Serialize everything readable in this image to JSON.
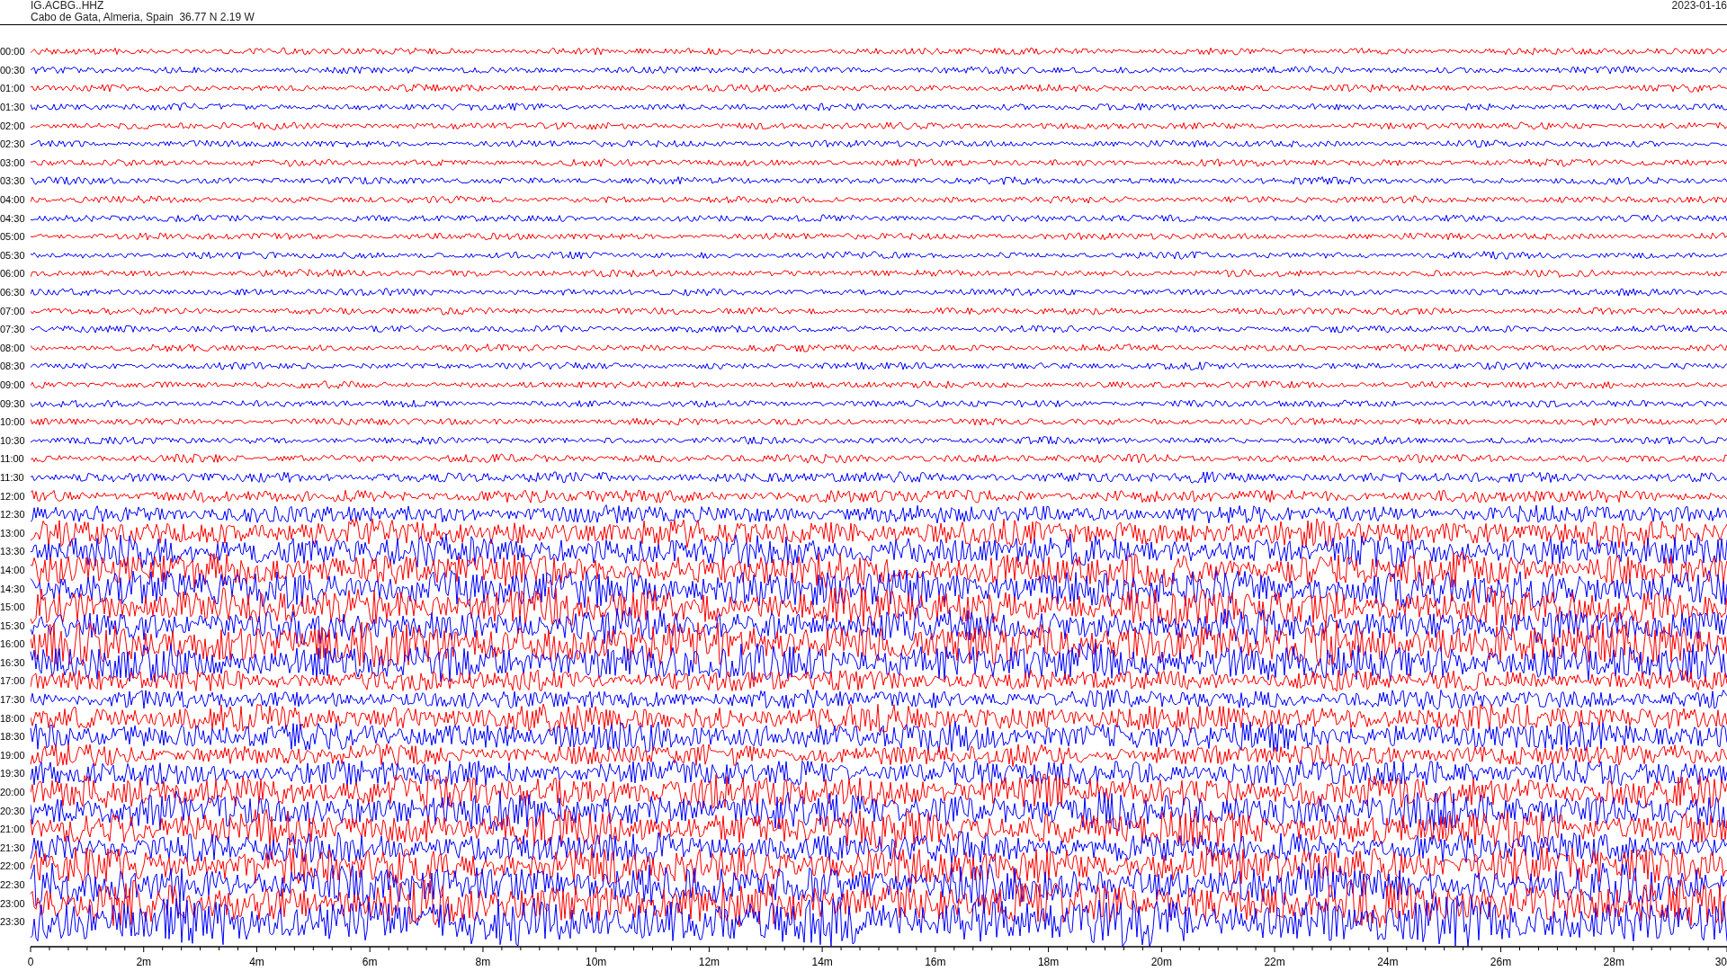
{
  "header": {
    "station": "IG.ACBG..HHZ",
    "location": "Cabo de Gata, Almeria, Spain  36.77 N 2.19 W",
    "date": "2023-01-16"
  },
  "traces": [
    {
      "time": "00:00",
      "color": "#ff0000"
    },
    {
      "time": "00:30",
      "color": "#0000ff"
    },
    {
      "time": "01:00",
      "color": "#ff0000"
    },
    {
      "time": "01:30",
      "color": "#0000ff"
    },
    {
      "time": "02:00",
      "color": "#ff0000"
    },
    {
      "time": "02:30",
      "color": "#0000ff"
    },
    {
      "time": "03:00",
      "color": "#ff0000"
    },
    {
      "time": "03:30",
      "color": "#0000ff"
    },
    {
      "time": "04:00",
      "color": "#ff0000"
    },
    {
      "time": "04:30",
      "color": "#0000ff"
    },
    {
      "time": "05:00",
      "color": "#ff0000"
    },
    {
      "time": "05:30",
      "color": "#0000ff"
    },
    {
      "time": "06:00",
      "color": "#ff0000"
    },
    {
      "time": "06:30",
      "color": "#0000ff"
    },
    {
      "time": "07:00",
      "color": "#ff0000"
    },
    {
      "time": "07:30",
      "color": "#0000ff"
    },
    {
      "time": "08:00",
      "color": "#ff0000"
    },
    {
      "time": "08:30",
      "color": "#0000ff"
    },
    {
      "time": "09:00",
      "color": "#ff0000"
    },
    {
      "time": "09:30",
      "color": "#0000ff"
    },
    {
      "time": "10:00",
      "color": "#ff0000"
    },
    {
      "time": "10:30",
      "color": "#0000ff"
    },
    {
      "time": "11:00",
      "color": "#ff0000"
    },
    {
      "time": "11:30",
      "color": "#0000ff"
    },
    {
      "time": "12:00",
      "color": "#ff0000"
    },
    {
      "time": "12:30",
      "color": "#0000ff"
    },
    {
      "time": "13:00",
      "color": "#ff0000"
    },
    {
      "time": "13:30",
      "color": "#0000ff"
    },
    {
      "time": "14:00",
      "color": "#ff0000"
    },
    {
      "time": "14:30",
      "color": "#0000ff"
    },
    {
      "time": "15:00",
      "color": "#ff0000"
    },
    {
      "time": "15:30",
      "color": "#0000ff"
    },
    {
      "time": "16:00",
      "color": "#ff0000"
    },
    {
      "time": "16:30",
      "color": "#0000ff"
    },
    {
      "time": "17:00",
      "color": "#ff0000"
    },
    {
      "time": "17:30",
      "color": "#0000ff"
    },
    {
      "time": "18:00",
      "color": "#ff0000"
    },
    {
      "time": "18:30",
      "color": "#0000ff"
    },
    {
      "time": "19:00",
      "color": "#ff0000"
    },
    {
      "time": "19:30",
      "color": "#0000ff"
    },
    {
      "time": "20:00",
      "color": "#ff0000"
    },
    {
      "time": "20:30",
      "color": "#0000ff"
    },
    {
      "time": "21:00",
      "color": "#ff0000"
    },
    {
      "time": "21:30",
      "color": "#0000ff"
    },
    {
      "time": "22:00",
      "color": "#ff0000"
    },
    {
      "time": "22:30",
      "color": "#0000ff"
    },
    {
      "time": "23:00",
      "color": "#ff0000"
    },
    {
      "time": "23:30",
      "color": "#0000ff"
    }
  ],
  "x_axis": {
    "ticks": [
      "0",
      "2m",
      "4m",
      "6m",
      "8m",
      "10m",
      "12m",
      "14m",
      "16m",
      "18m",
      "20m",
      "22m",
      "24m",
      "26m",
      "28m",
      "30"
    ]
  }
}
